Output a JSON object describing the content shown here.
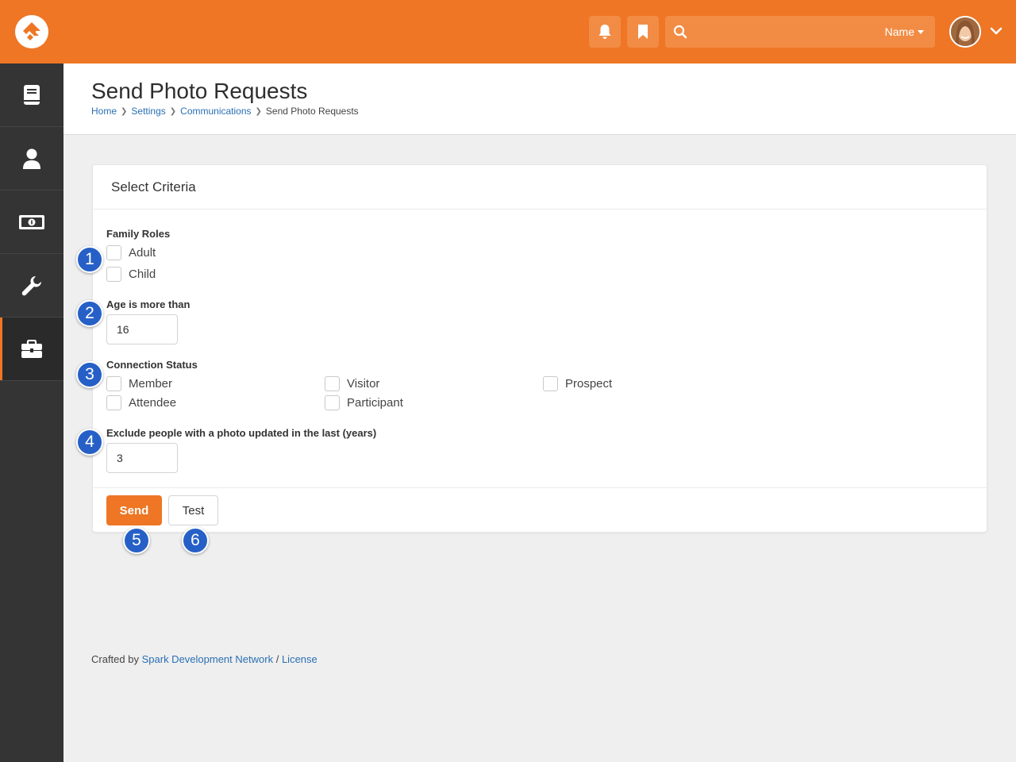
{
  "header": {
    "search_scope": "Name",
    "search_placeholder": ""
  },
  "page": {
    "title": "Send Photo Requests",
    "breadcrumb": [
      "Home",
      "Settings",
      "Communications",
      "Send Photo Requests"
    ]
  },
  "panel": {
    "title": "Select Criteria",
    "family_roles": {
      "label": "Family Roles",
      "options": [
        {
          "label": "Adult",
          "checked": false
        },
        {
          "label": "Child",
          "checked": false
        }
      ]
    },
    "age": {
      "label": "Age is more than",
      "value": "16"
    },
    "connection_status": {
      "label": "Connection Status",
      "options": [
        {
          "label": "Member",
          "checked": false
        },
        {
          "label": "Visitor",
          "checked": false
        },
        {
          "label": "Prospect",
          "checked": false
        },
        {
          "label": "Attendee",
          "checked": false
        },
        {
          "label": "Participant",
          "checked": false
        }
      ]
    },
    "exclude": {
      "label": "Exclude people with a photo updated in the last (years)",
      "value": "3"
    },
    "send_label": "Send",
    "test_label": "Test"
  },
  "callouts": [
    "1",
    "2",
    "3",
    "4",
    "5",
    "6"
  ],
  "footer": {
    "prefix": "Crafted by",
    "org": "Spark Development Network",
    "separator": "/",
    "license": "License"
  },
  "colors": {
    "brand": "#ee7625",
    "sidebar": "#343434",
    "link": "#2a6fb3",
    "callout": "#2660c7"
  }
}
